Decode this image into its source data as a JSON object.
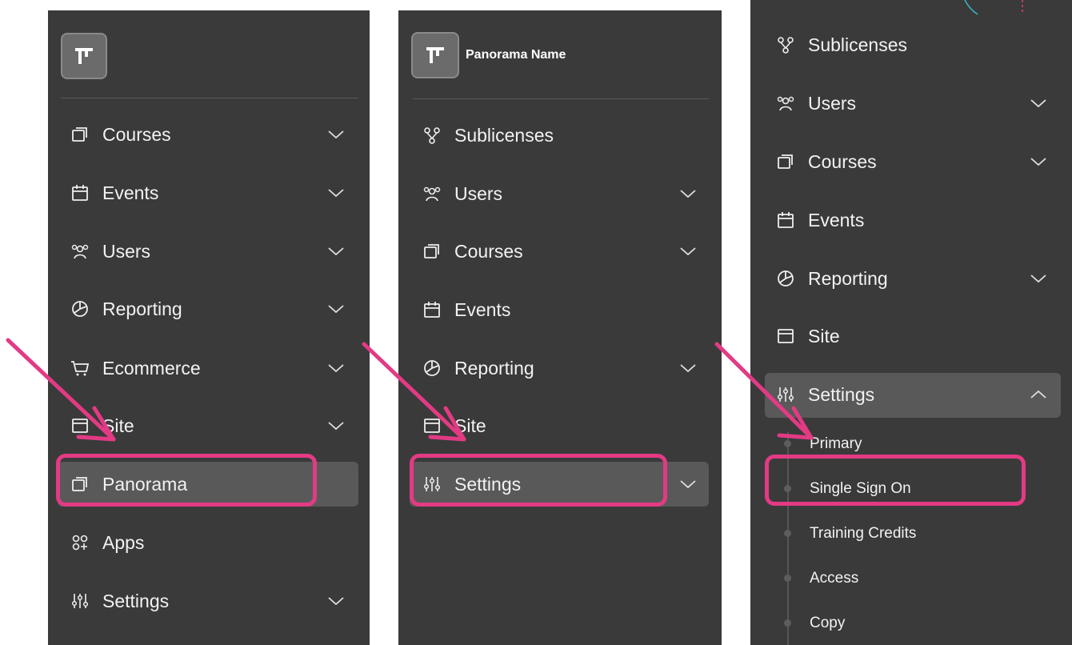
{
  "panel1": {
    "items": [
      {
        "label": "Courses",
        "icon": "courses-icon",
        "chevron": true
      },
      {
        "label": "Events",
        "icon": "calendar-icon",
        "chevron": true
      },
      {
        "label": "Users",
        "icon": "users-icon",
        "chevron": true
      },
      {
        "label": "Reporting",
        "icon": "reporting-icon",
        "chevron": true
      },
      {
        "label": "Ecommerce",
        "icon": "cart-icon",
        "chevron": true
      },
      {
        "label": "Site",
        "icon": "site-icon",
        "chevron": true
      },
      {
        "label": "Panorama",
        "icon": "panorama-icon",
        "chevron": false,
        "active": true
      },
      {
        "label": "Apps",
        "icon": "apps-icon",
        "chevron": false
      },
      {
        "label": "Settings",
        "icon": "settings-icon",
        "chevron": true
      }
    ]
  },
  "panel2": {
    "org_name": "Panorama Name",
    "items": [
      {
        "label": "Sublicenses",
        "icon": "sublicenses-icon",
        "chevron": false
      },
      {
        "label": "Users",
        "icon": "users-icon",
        "chevron": true
      },
      {
        "label": "Courses",
        "icon": "courses-icon",
        "chevron": true
      },
      {
        "label": "Events",
        "icon": "calendar-icon",
        "chevron": false
      },
      {
        "label": "Reporting",
        "icon": "reporting-icon",
        "chevron": true
      },
      {
        "label": "Site",
        "icon": "site-icon",
        "chevron": false
      },
      {
        "label": "Settings",
        "icon": "settings-icon",
        "chevron": true,
        "active": true
      }
    ]
  },
  "panel3": {
    "items": [
      {
        "label": "Sublicenses",
        "icon": "sublicenses-icon",
        "chevron": false
      },
      {
        "label": "Users",
        "icon": "users-icon",
        "chevron": true
      },
      {
        "label": "Courses",
        "icon": "courses-icon",
        "chevron": true
      },
      {
        "label": "Events",
        "icon": "calendar-icon",
        "chevron": false
      },
      {
        "label": "Reporting",
        "icon": "reporting-icon",
        "chevron": true
      },
      {
        "label": "Site",
        "icon": "site-icon",
        "chevron": false
      },
      {
        "label": "Settings",
        "icon": "settings-icon",
        "chevron": "up",
        "active": true
      }
    ],
    "subitems": [
      "Primary",
      "Single Sign On",
      "Training Credits",
      "Access",
      "Copy"
    ]
  },
  "colors": {
    "panel_bg": "#3a3a3a",
    "active_bg": "#595959",
    "highlight": "#e33a84",
    "text": "#f2f2f2"
  }
}
